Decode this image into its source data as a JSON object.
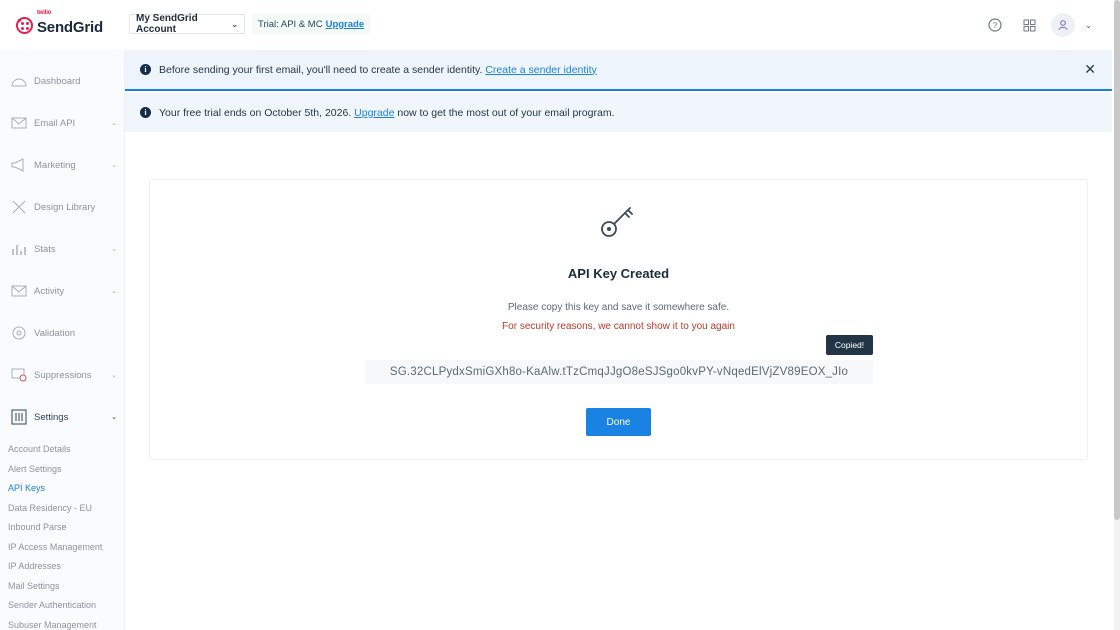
{
  "header": {
    "logo_small": "twilio",
    "logo_text": "SendGrid",
    "account_label": "My SendGrid Account",
    "trial_label": "Trial: API & MC",
    "trial_upgrade": "Upgrade",
    "icons": [
      "help-icon",
      "apps-grid-icon",
      "user-icon",
      "chevron-down-icon"
    ]
  },
  "sidebar": {
    "items": [
      {
        "label": "Dashboard",
        "icon": "dashboard-icon"
      },
      {
        "label": "Email API",
        "icon": "email-icon",
        "expandable": true
      },
      {
        "label": "Marketing",
        "icon": "megaphone-icon",
        "expandable": true
      },
      {
        "label": "Design Library",
        "icon": "design-icon"
      },
      {
        "label": "Stats",
        "icon": "stats-icon",
        "expandable": true
      },
      {
        "label": "Activity",
        "icon": "activity-icon",
        "expandable": true
      },
      {
        "label": "Validation",
        "icon": "validation-icon"
      },
      {
        "label": "Suppressions",
        "icon": "suppressions-icon",
        "expandable": true
      },
      {
        "label": "Settings",
        "icon": "settings-icon",
        "expandable": true,
        "active": true
      }
    ],
    "settings_sub": [
      "Account Details",
      "Alert Settings",
      "API Keys",
      "Data Residency - EU",
      "Inbound Parse",
      "IP Access Management",
      "IP Addresses",
      "Mail Settings",
      "Sender Authentication",
      "Subuser Management"
    ],
    "active_sub": "API Keys"
  },
  "banners": {
    "sender": {
      "text": "Before sending your first email, you'll need to create a sender identity.",
      "link": "Create a sender identity"
    },
    "trial": {
      "before": "Your free trial ends on October 5th, 2026.",
      "link": "Upgrade",
      "after": "now to get the most out of your email program."
    }
  },
  "card": {
    "title": "API Key Created",
    "note": "Please copy this key and save it somewhere safe.",
    "warning": "For security reasons, we cannot show it to you again",
    "api_key": "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",
    "copied_tooltip": "Copied!",
    "done_label": "Done"
  },
  "colors": {
    "accent": "#1a82e2",
    "warning": "#c0392b",
    "brand": "#e0224e"
  }
}
